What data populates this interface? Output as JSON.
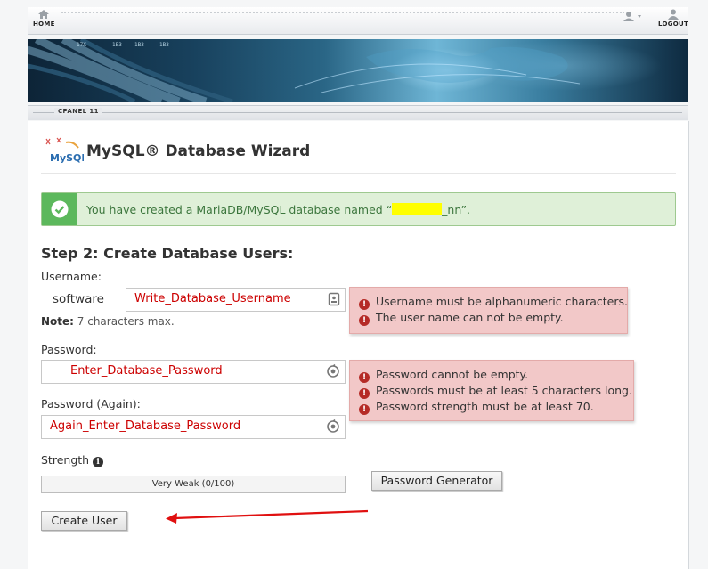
{
  "nav": {
    "home_label": "HOME",
    "logout_label": "LOGOUT",
    "user_icon": "user-icon",
    "home_icon": "home-icon",
    "logout_icon": "logout-icon"
  },
  "subbar": {
    "label": "CPANEL 11"
  },
  "header": {
    "title": "MySQL® Database Wizard",
    "logo_text": "MySQL"
  },
  "alert": {
    "text_before": "You have created a MariaDB/MySQL database named “",
    "text_after": "_nn”.",
    "icon": "check-icon",
    "color": "#dff0d8"
  },
  "step": {
    "title": "Step 2: Create Database Users:"
  },
  "username": {
    "label": "Username:",
    "prefix": "software_",
    "value": "Write_Database_Username",
    "note_bold": "Note:",
    "note_text": " 7 characters max.",
    "errors": [
      "Username must be alphanumeric characters.",
      "The user name can not be empty."
    ]
  },
  "password": {
    "label": "Password:",
    "value": "Enter_Database_Password",
    "errors": [
      "Password cannot be empty.",
      "Passwords must be at least 5 characters long.",
      "Password strength must be at least 70."
    ]
  },
  "password_again": {
    "label": "Password (Again):",
    "value": "Again_Enter_Database_Password"
  },
  "strength": {
    "label": "Strength",
    "meter_text": "Very Weak (0/100)",
    "value": 0
  },
  "buttons": {
    "generator": "Password Generator",
    "create_user": "Create User"
  },
  "colors": {
    "error_bg": "#f2c8c8",
    "error_icon": "#b52b27",
    "field_text": "#cc0000",
    "arrow": "#e01010"
  }
}
